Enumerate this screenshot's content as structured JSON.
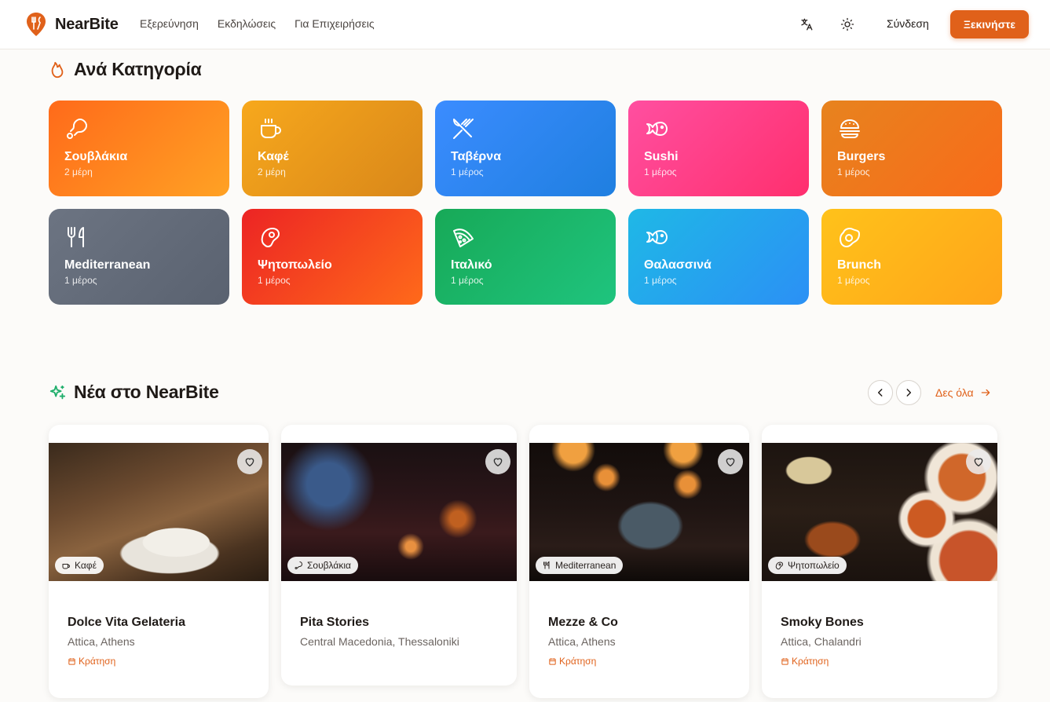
{
  "brand": {
    "name": "NearBite",
    "accent": "#e0611a"
  },
  "nav": {
    "items": [
      {
        "label": "Εξερεύνηση"
      },
      {
        "label": "Εκδηλώσεις"
      },
      {
        "label": "Για Επιχειρήσεις"
      }
    ],
    "translate_icon": "translate-icon",
    "theme_icon": "sun-icon",
    "login_label": "Σύνδεση",
    "start_label": "Ξεκινήστε"
  },
  "categories_section": {
    "title": "Ανά Κατηγορία",
    "icon": "flame-icon",
    "items": [
      {
        "name": "Σουβλάκια",
        "count": "2 μέρη",
        "icon": "drumstick-icon",
        "gradient": [
          "#ff6a1a",
          "#ffa224"
        ]
      },
      {
        "name": "Καφέ",
        "count": "2 μέρη",
        "icon": "coffee-icon",
        "gradient": [
          "#f7a81c",
          "#d9871a"
        ]
      },
      {
        "name": "Ταβέρνα",
        "count": "1 μέρος",
        "icon": "utensils-crossed-icon",
        "gradient": [
          "#3b8cff",
          "#1f7fe0"
        ]
      },
      {
        "name": "Sushi",
        "count": "1 μέρος",
        "icon": "fish-icon",
        "gradient": [
          "#ff4fa0",
          "#ff2f6e"
        ]
      },
      {
        "name": "Burgers",
        "count": "1 μέρος",
        "icon": "burger-icon",
        "gradient": [
          "#e7831e",
          "#f86b1a"
        ]
      },
      {
        "name": "Mediterranean",
        "count": "1 μέρος",
        "icon": "utensils-icon",
        "gradient": [
          "#6c7482",
          "#5a6270"
        ]
      },
      {
        "name": "Ψητοπωλείο",
        "count": "1 μέρος",
        "icon": "steak-icon",
        "gradient": [
          "#ec2424",
          "#ff6a1a"
        ]
      },
      {
        "name": "Ιταλικό",
        "count": "1 μέρος",
        "icon": "pizza-icon",
        "gradient": [
          "#17a957",
          "#1fc47e"
        ]
      },
      {
        "name": "Θαλασσινά",
        "count": "1 μέρος",
        "icon": "fish-icon",
        "gradient": [
          "#1fb8e6",
          "#2b90f5"
        ]
      },
      {
        "name": "Brunch",
        "count": "1 μέρος",
        "icon": "egg-icon",
        "gradient": [
          "#ffc21a",
          "#ffa51a"
        ]
      }
    ]
  },
  "new_section": {
    "title": "Νέα στο NearBite",
    "icon": "sparkles-icon",
    "see_all_label": "Δες όλα",
    "venues": [
      {
        "name": "Dolce Vita Gelateria",
        "location": "Attica, Athens",
        "tag": "Καφέ",
        "tag_icon": "coffee-icon",
        "booking": "Κράτηση"
      },
      {
        "name": "Pita Stories",
        "location": "Central Macedonia, Thessaloniki",
        "tag": "Σουβλάκια",
        "tag_icon": "drumstick-icon",
        "booking": ""
      },
      {
        "name": "Mezze & Co",
        "location": "Attica, Athens",
        "tag": "Mediterranean",
        "tag_icon": "utensils-icon",
        "booking": "Κράτηση"
      },
      {
        "name": "Smoky Bones",
        "location": "Attica, Chalandri",
        "tag": "Ψητοπωλείο",
        "tag_icon": "steak-icon",
        "booking": "Κράτηση"
      }
    ]
  }
}
